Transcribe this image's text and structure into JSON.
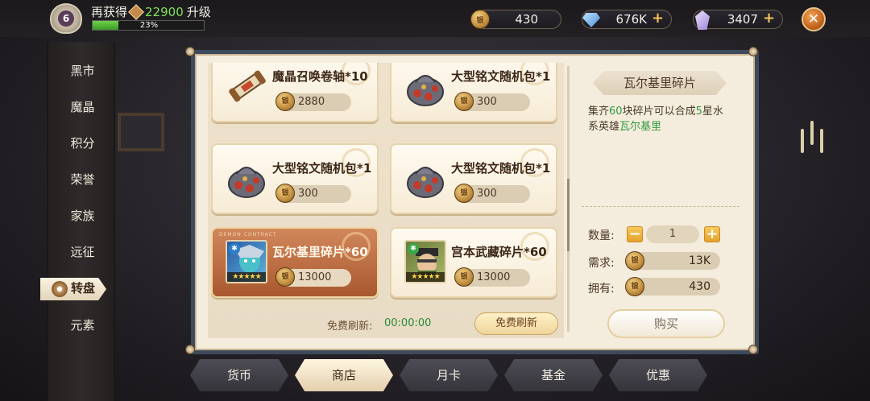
{
  "player": {
    "level": "6",
    "upgrade_prefix": "再获得",
    "upgrade_amount": "22900",
    "upgrade_suffix": "升级",
    "exp_percent_label": "23%",
    "exp_fraction": 0.23
  },
  "currencies": {
    "coin": "430",
    "diamond": "676K",
    "crystal": "3407",
    "plus_glyph": "+",
    "coin_glyph": "银"
  },
  "close_glyph": "✕",
  "sidebar": {
    "items": [
      {
        "label": "黑市"
      },
      {
        "label": "魔晶"
      },
      {
        "label": "积分"
      },
      {
        "label": "荣誉"
      },
      {
        "label": "家族"
      },
      {
        "label": "远征"
      },
      {
        "label": "转盘",
        "active": true
      },
      {
        "label": "元素"
      }
    ]
  },
  "shop": {
    "items": [
      {
        "title": "魔晶召唤卷轴*10",
        "price": "2880",
        "icon": "scroll-icon"
      },
      {
        "title": "大型铭文随机包*1",
        "price": "300",
        "icon": "rune-bag-icon"
      },
      {
        "title": "大型铭文随机包*1",
        "price": "300",
        "icon": "rune-bag-icon"
      },
      {
        "title": "大型铭文随机包*1",
        "price": "300",
        "icon": "rune-bag-icon"
      },
      {
        "title": "瓦尔基里碎片*60",
        "price": "13000",
        "icon": "valkyrie-portrait",
        "selected": true,
        "stars": "★★★★★",
        "badge": "DEMON CONTRACT"
      },
      {
        "title": "宫本武藏碎片*60",
        "price": "13000",
        "icon": "musashi-portrait",
        "stars": "★★★★★"
      }
    ],
    "refresh_label": "免费刷新:",
    "refresh_timer": "00:00:00",
    "refresh_button": "免费刷新"
  },
  "detail": {
    "title": "瓦尔基里碎片",
    "desc_1": "集齐",
    "desc_num": "60",
    "desc_2": "块碎片可以合成",
    "desc_star": "5",
    "desc_3": "星水系英雄",
    "desc_hero": "瓦尔基里",
    "qty_label": "数量:",
    "qty_value": "1",
    "minus_glyph": "−",
    "plus_glyph": "+",
    "need_label": "需求:",
    "need_value": "13K",
    "own_label": "拥有:",
    "own_value": "430",
    "buy_button": "购买"
  },
  "tabs": [
    {
      "label": "货币"
    },
    {
      "label": "商店",
      "active": true
    },
    {
      "label": "月卡"
    },
    {
      "label": "基金"
    },
    {
      "label": "优惠"
    }
  ],
  "colors": {
    "accent_green": "#2f9a3c",
    "exp_green": "#6fd24a",
    "selected_card": "#b8683c",
    "panel_border": "#3c4a5c"
  }
}
